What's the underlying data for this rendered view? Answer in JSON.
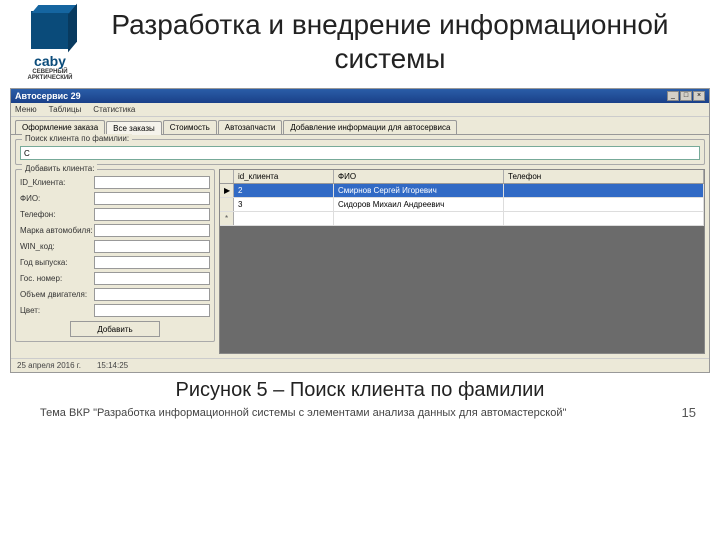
{
  "slide": {
    "title": "Разработка и внедрение информационной системы",
    "logo_main": "caby",
    "logo_sub1": "СЕВЕРНЫЙ",
    "logo_sub2": "АРКТИЧЕСКИЙ",
    "caption": "Рисунок 5 – Поиск клиента по фамилии",
    "footer": "Тема ВКР \"Разработка информационной системы с элементами анализа данных для автомастерской\"",
    "page": "15"
  },
  "window": {
    "title": "Автосервис 29",
    "menu": [
      "Меню",
      "Таблицы",
      "Статистика"
    ],
    "tabs": [
      "Оформление заказа",
      "Все заказы",
      "Стоимость",
      "Автозапчасти",
      "Добавление информации для автосервиса"
    ],
    "active_tab": 1,
    "search_group": "Поиск клиента по фамилии:",
    "search_value": "С",
    "add_group": "Добавить клиента:",
    "form_labels": {
      "id": "ID_Клиента:",
      "fio": "ФИО:",
      "tel": "Телефон:",
      "brand": "Марка автомобиля:",
      "vin": "WIN_код:",
      "year": "Год выпуска:",
      "plate": "Гос. номер:",
      "engine": "Объем двигателя:",
      "color": "Цвет:"
    },
    "add_button": "Добавить",
    "grid": {
      "headers": {
        "id": "id_клиента",
        "fio": "ФИО",
        "tel": "Телефон"
      },
      "rows": [
        {
          "sel": "▶",
          "id": "2",
          "fio": "Смирнов Сергей Игоревич",
          "tel": ""
        },
        {
          "sel": "",
          "id": "3",
          "fio": "Сидоров Михаил Андреевич",
          "tel": ""
        }
      ],
      "new_marker": "*"
    },
    "status": {
      "date": "25 апреля 2016 г.",
      "time": "15:14:25"
    }
  }
}
